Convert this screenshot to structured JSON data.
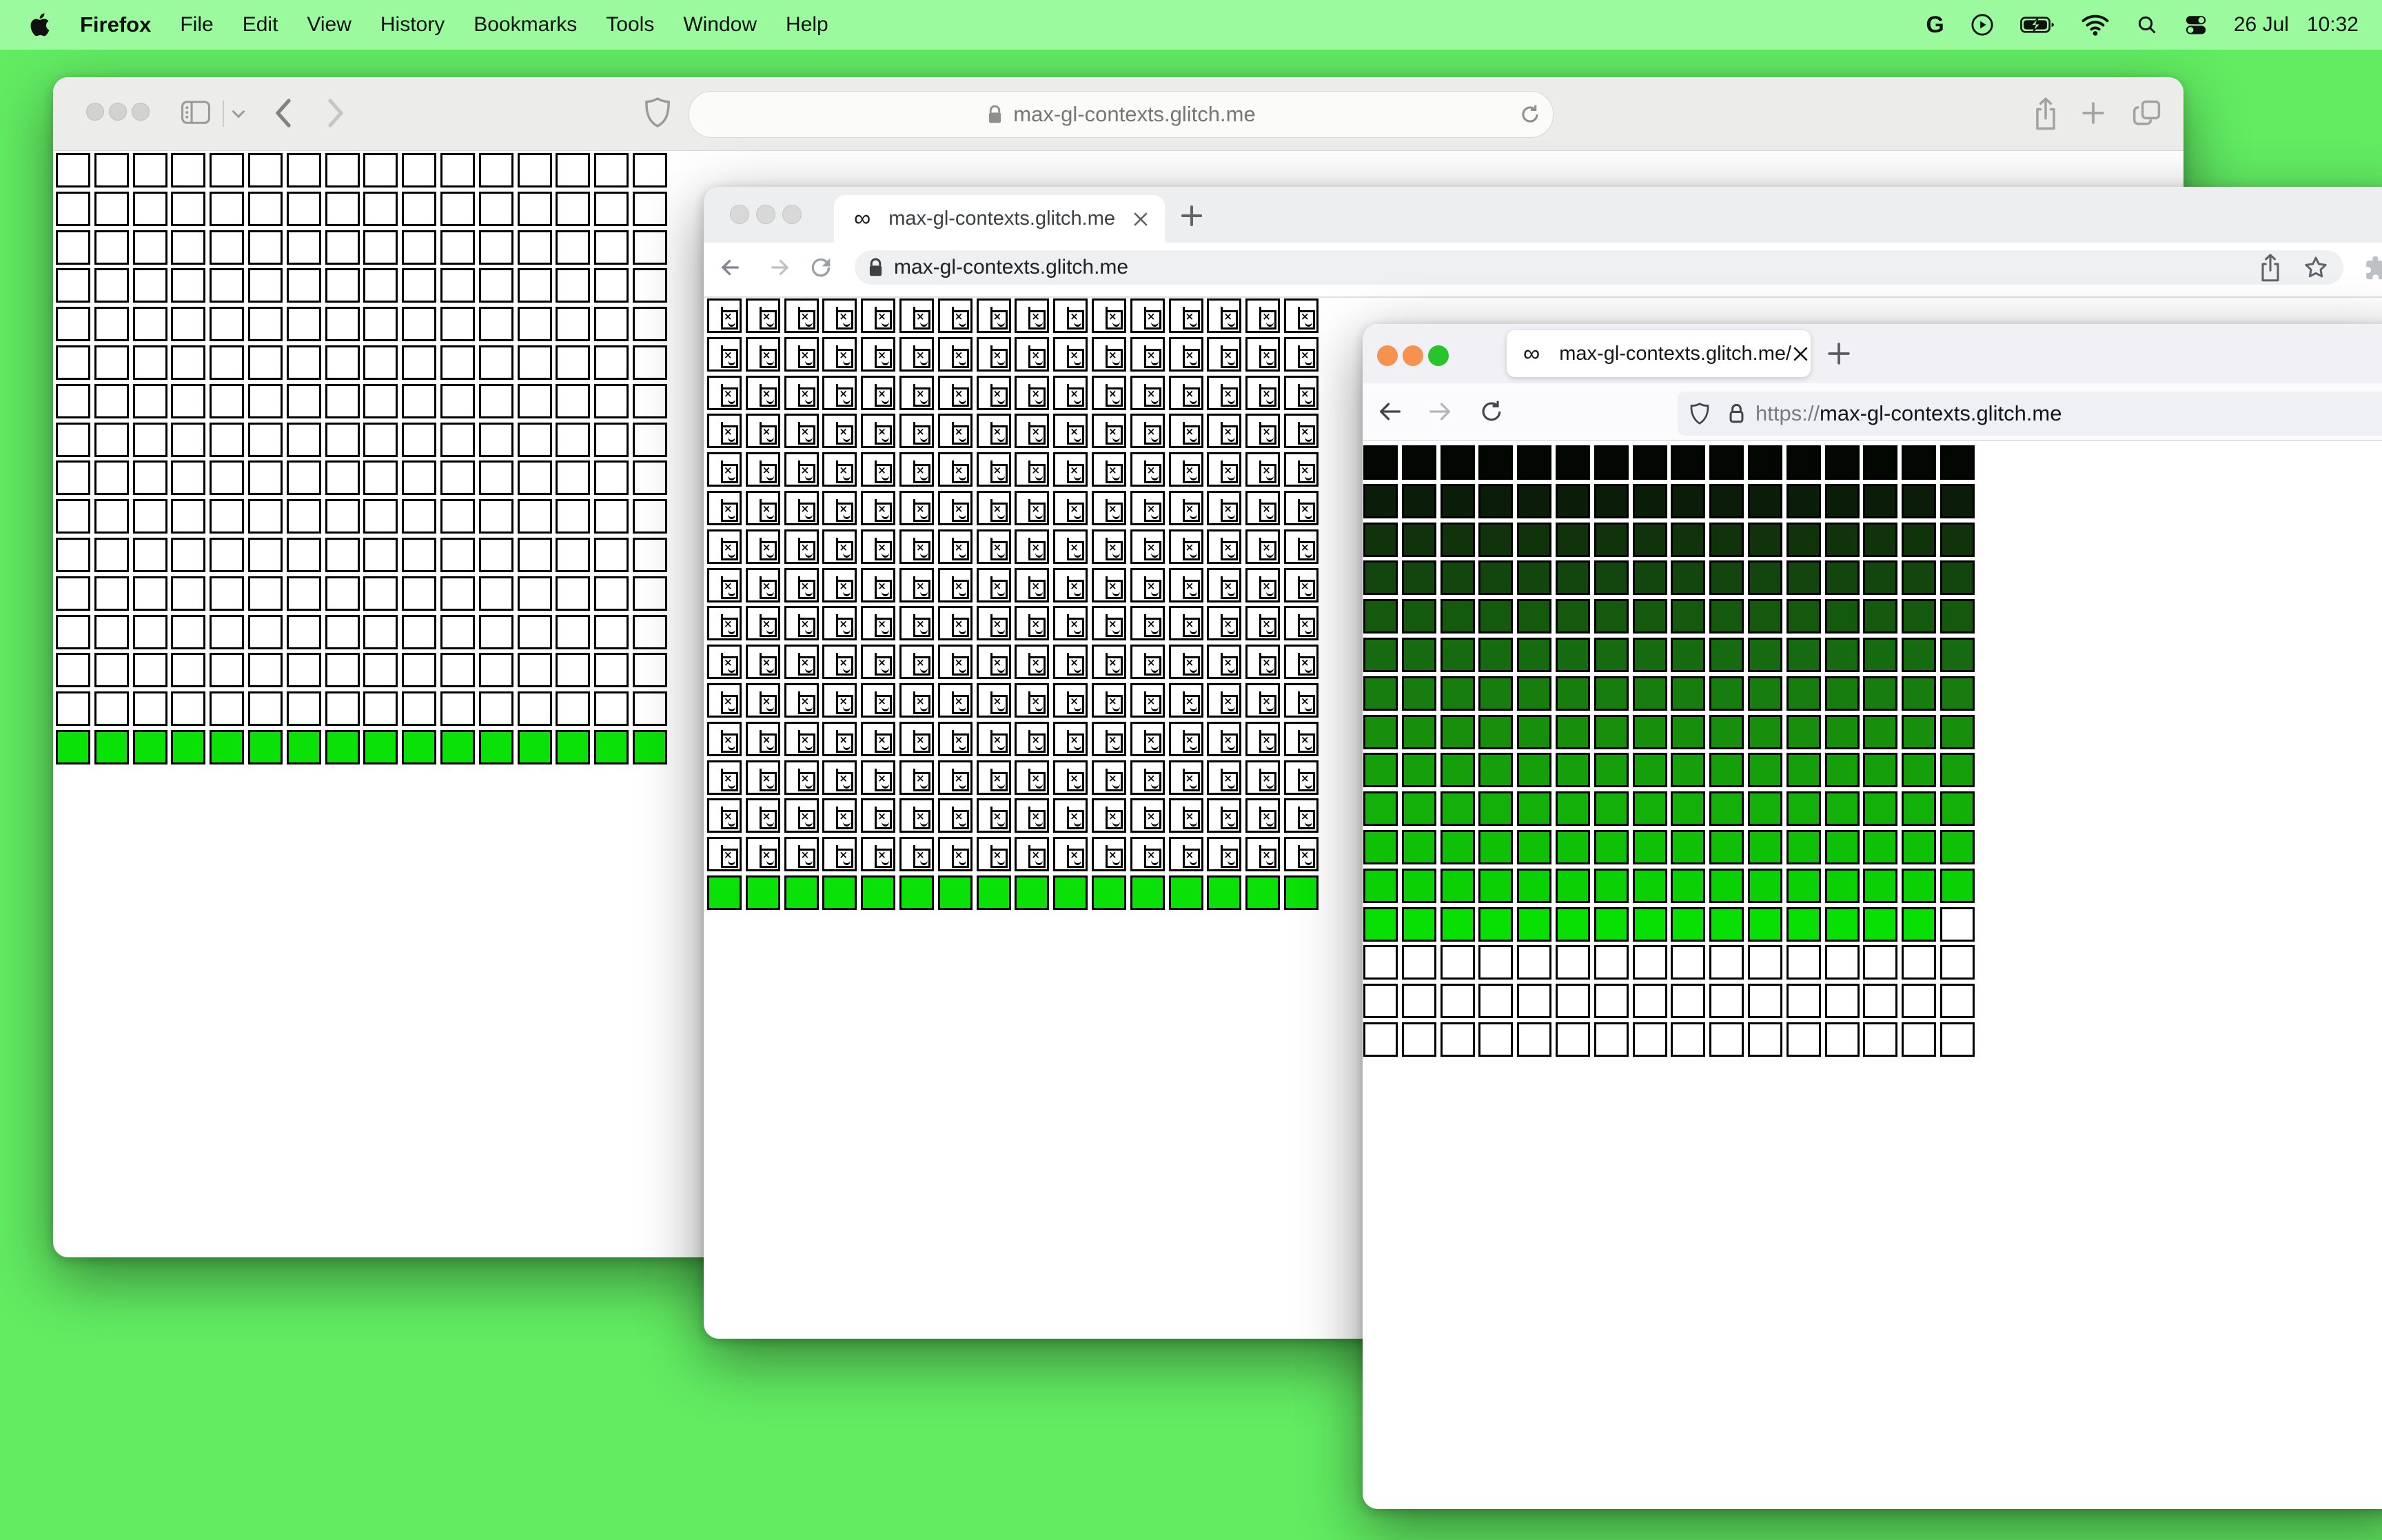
{
  "menu_bar": {
    "app_name": "Firefox",
    "items": [
      "File",
      "Edit",
      "View",
      "History",
      "Bookmarks",
      "Tools",
      "Window",
      "Help"
    ],
    "status_icons": [
      "google-icon",
      "play-circle-icon",
      "battery-charging-icon",
      "wifi-icon",
      "search-icon",
      "control-center-icon"
    ],
    "google_glyph": "G",
    "date": "26 Jul",
    "time": "10:32"
  },
  "safari_window": {
    "url": "max-gl-contexts.glitch.me",
    "toolbar_icons": [
      "sidebar-icon",
      "chevron-down-icon",
      "back-icon",
      "forward-icon",
      "privacy-shield-icon",
      "lock-icon",
      "reload-icon",
      "share-icon",
      "new-tab-icon",
      "tab-overview-icon"
    ]
  },
  "chrome_window": {
    "favicon": "∞",
    "tab_title": "max-gl-contexts.glitch.me",
    "url": "max-gl-contexts.glitch.me",
    "toolbar_icons": [
      "back-icon",
      "forward-icon",
      "reload-icon",
      "lock-icon",
      "share-icon",
      "bookmark-star-icon",
      "extensions-puzzle-icon"
    ]
  },
  "firefox_window": {
    "favicon": "∞",
    "tab_title": "max-gl-contexts.glitch.me/",
    "url_scheme": "https://",
    "url_host": "max-gl-contexts.glitch.me",
    "toolbar_icons": [
      "back-icon",
      "forward-icon",
      "reload-icon",
      "tracking-shield-icon",
      "lock-icon"
    ]
  },
  "colors": {
    "desktop": "#62ec62",
    "menubar": "#9bf99e",
    "bright_green": "#0ae107",
    "firefox_traffic_lights": [
      "#f5924e",
      "#f5924e",
      "#28c32d"
    ],
    "inactive_traffic_light": "#d4d4d1"
  },
  "grids": {
    "safari": {
      "cols": 16,
      "rows": 16,
      "pitch": 55.8,
      "cell": 50,
      "row_fills": [
        "#ffffff",
        "#ffffff",
        "#ffffff",
        "#ffffff",
        "#ffffff",
        "#ffffff",
        "#ffffff",
        "#ffffff",
        "#ffffff",
        "#ffffff",
        "#ffffff",
        "#ffffff",
        "#ffffff",
        "#ffffff",
        "#ffffff",
        "#0ae107"
      ]
    },
    "chrome": {
      "cols": 16,
      "rows": 16,
      "pitch": 55.8,
      "cell": 50,
      "broken_rows": 15,
      "row_fills": [
        "#ffffff",
        "#ffffff",
        "#ffffff",
        "#ffffff",
        "#ffffff",
        "#ffffff",
        "#ffffff",
        "#ffffff",
        "#ffffff",
        "#ffffff",
        "#ffffff",
        "#ffffff",
        "#ffffff",
        "#ffffff",
        "#ffffff",
        "#0ae107"
      ]
    },
    "firefox": {
      "cols": 16,
      "rows": 16,
      "pitch": 55.8,
      "cell": 50,
      "row_fills": [
        "#020702",
        "#0a1d08",
        "#10330c",
        "#13460e",
        "#15590f",
        "#166b10",
        "#177d0f",
        "#178f0d",
        "#15a00b",
        "#12b009",
        "#0ec106",
        "#0ad104",
        "#08df03",
        "#ffffff",
        "#ffffff",
        "#ffffff"
      ],
      "overrides": {
        "12,15": "#ffffff"
      }
    }
  }
}
